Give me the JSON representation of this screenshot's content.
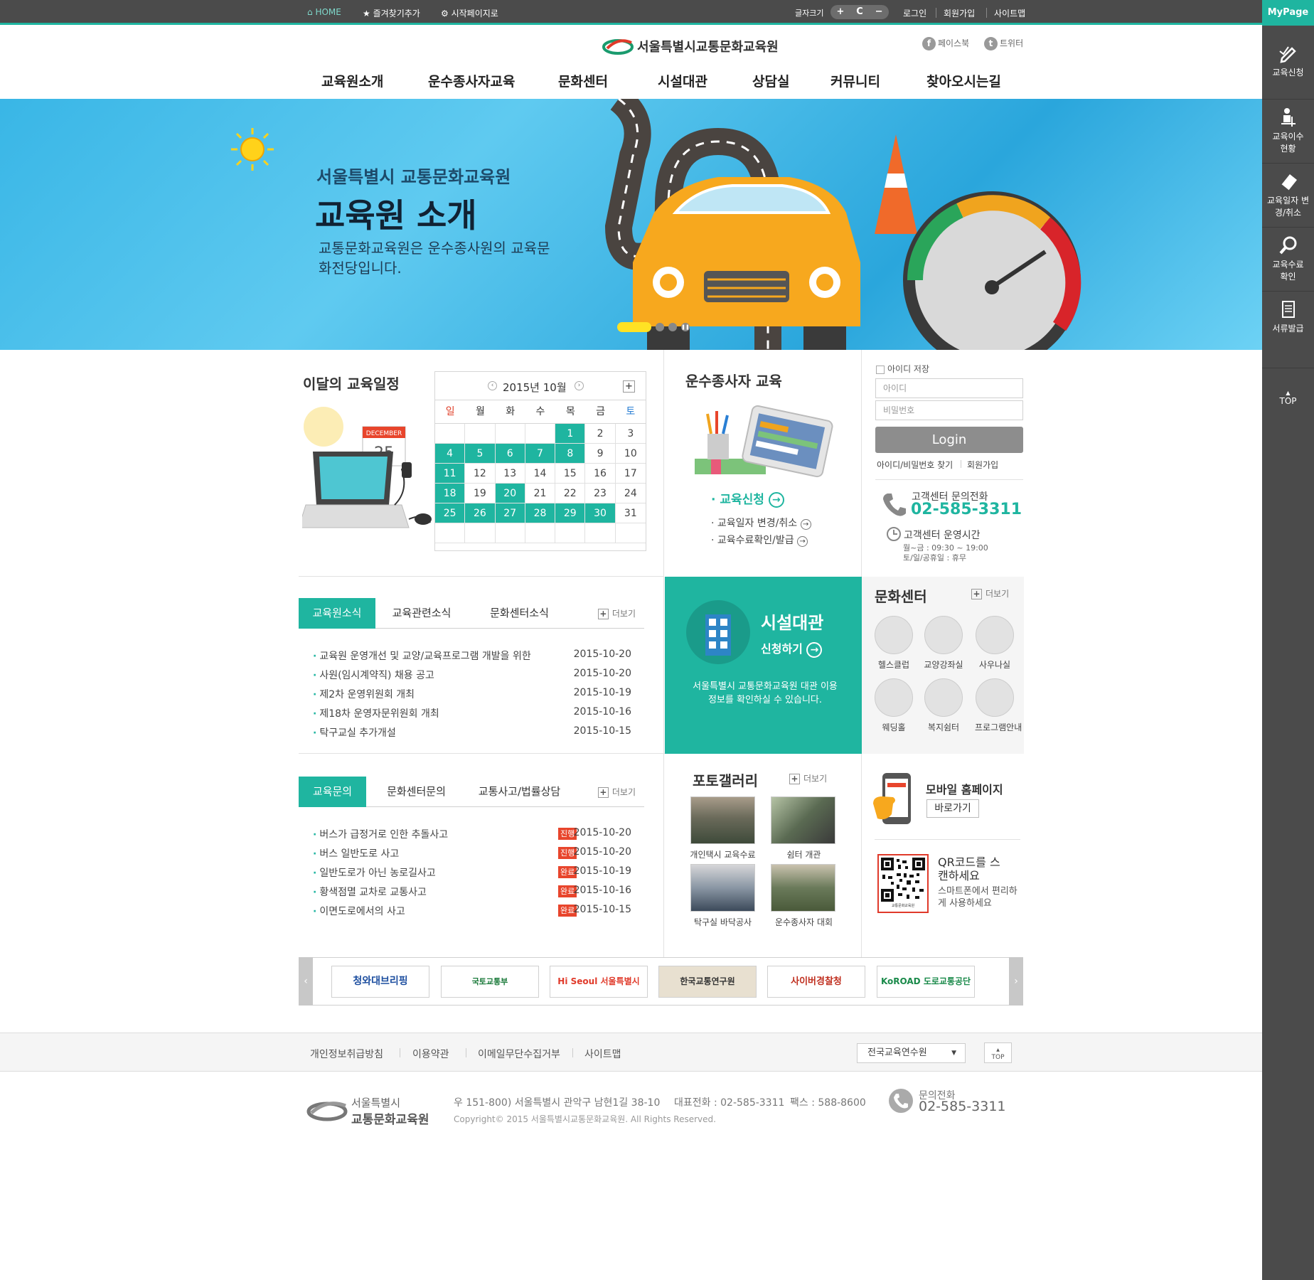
{
  "topbar": {
    "home": "HOME",
    "bookmark": "즐겨찾기추가",
    "startpage": "시작페이지로",
    "fontsize_label": "글자크기",
    "font_plus": "+",
    "font_reset": "C",
    "font_minus": "−",
    "login": "로그인",
    "join": "회원가입",
    "sitemap": "사이트맵"
  },
  "right_panel": {
    "mypage": "MyPage",
    "items": [
      "교육신청",
      "교육이수 현황",
      "교육일자 변경/취소",
      "교육수료 확인",
      "서류발급"
    ],
    "top": "TOP"
  },
  "header": {
    "logo": "서울특별시교통문화교육원",
    "facebook": "페이스북",
    "twitter": "트위터",
    "nav": [
      "교육원소개",
      "운수종사자교육",
      "문화센터",
      "시설대관",
      "상담실",
      "커뮤니티",
      "찾아오시는길"
    ]
  },
  "banner": {
    "subtitle": "서울특별시 교통문화교육원",
    "title": "교육원 소개",
    "desc": "교통문화교육원은 운수종사원의 교육문화전당입니다."
  },
  "schedule": {
    "title": "이달의 교육일정",
    "calendar_title": "2015년 10월",
    "illustration_text": "DECEMBER",
    "illustration_day": "25",
    "days": [
      "일",
      "월",
      "화",
      "수",
      "목",
      "금",
      "토"
    ],
    "cells": [
      "",
      "",
      "",
      "",
      "1",
      "2",
      "3",
      "4",
      "5",
      "6",
      "7",
      "8",
      "9",
      "10",
      "11",
      "12",
      "13",
      "14",
      "15",
      "16",
      "17",
      "18",
      "19",
      "20",
      "21",
      "22",
      "23",
      "24",
      "25",
      "26",
      "27",
      "28",
      "29",
      "30",
      "31",
      "",
      "",
      "",
      "",
      "",
      "",
      ""
    ],
    "highlighted": [
      "1",
      "4",
      "5",
      "6",
      "7",
      "8",
      "11",
      "18",
      "20",
      "25",
      "26",
      "27",
      "28",
      "29",
      "30"
    ],
    "colors": {
      "accent": "#1fb5a0",
      "sunday": "#e0402a",
      "saturday": "#2a7fd4"
    }
  },
  "driver_edu": {
    "title": "운수종사자 교육",
    "apply": "교육신청",
    "links": [
      "교육일자 변경/취소",
      "교육수료확인/발급"
    ]
  },
  "login": {
    "save_id": "아이디 저장",
    "id_placeholder": "아이디",
    "pw_placeholder": "비밀번호",
    "button": "Login",
    "find": "아이디/비밀번호 찾기",
    "join": "회원가입",
    "cs_label": "고객센터 문의전화",
    "cs_phone": "02-585-3311",
    "hours_label": "고객센터 운영시간",
    "hours_weekday": "월~금 : 09:30 ~ 19:00",
    "hours_weekend": "토/일/공휴일 : 휴무"
  },
  "news": {
    "tabs": [
      "교육원소식",
      "교육관련소식",
      "문화센터소식"
    ],
    "more": "더보기",
    "items": [
      {
        "title": "교육원 운영개선 및 교양/교육프로그램 개발을 위한",
        "date": "2015-10-20"
      },
      {
        "title": "사원(임시계약직) 채용 공고",
        "date": "2015-10-20"
      },
      {
        "title": "제2차 운영위원회 개최",
        "date": "2015-10-19"
      },
      {
        "title": "제18차 운영자문위원회 개최",
        "date": "2015-10-16"
      },
      {
        "title": "탁구교실 추가개설",
        "date": "2015-10-15"
      }
    ]
  },
  "facility": {
    "title": "시설대관",
    "apply": "신청하기",
    "desc": "서울특별시 교통문화교육원 대관 이용정보를 확인하실 수 있습니다."
  },
  "culture": {
    "title": "문화센터",
    "more": "더보기",
    "items": [
      "헬스클럽",
      "교양강좌실",
      "사우나실",
      "웨딩홀",
      "복지쉼터",
      "프로그램안내"
    ]
  },
  "inquiry": {
    "tabs": [
      "교육문의",
      "문화센터문의",
      "교통사고/법률상담"
    ],
    "more": "더보기",
    "items": [
      {
        "title": "버스가 급정거로 인한 추돌사고",
        "status": "진행",
        "date": "2015-10-20"
      },
      {
        "title": "버스 일반도로 사고",
        "status": "진행",
        "date": "2015-10-20"
      },
      {
        "title": "일반도로가 아닌 농로길사고",
        "status": "완료",
        "date": "2015-10-19"
      },
      {
        "title": "황색점멸 교차로 교통사고",
        "status": "완료",
        "date": "2015-10-16"
      },
      {
        "title": "이면도로에서의 사고",
        "status": "완료",
        "date": "2015-10-15"
      }
    ],
    "status_colors": {
      "진행": "#e8452c",
      "완료": "#e8452c"
    }
  },
  "gallery": {
    "title": "포토갤러리",
    "more": "더보기",
    "items": [
      "개인택시 교육수료",
      "쉼터 개관",
      "탁구실 바닥공사",
      "운수종사자 대회"
    ]
  },
  "mobile": {
    "title": "모바일 홈페이지",
    "button": "바로가기",
    "qr_title": "QR코드를 스캔하세요",
    "qr_desc": "스마트폰에서 편리하게 사용하세요",
    "qr_caption": "교통문화교육원"
  },
  "partners": {
    "prev": "‹",
    "next": "›",
    "items": [
      "청와대브리핑",
      "국토교통부",
      "Hi Seoul 서울특별시",
      "한국교통연구원",
      "사이버경찰청",
      "KoROAD 도로교통공단"
    ]
  },
  "footer": {
    "links": [
      "개인정보취급방침",
      "이용약관",
      "이메일무단수집거부",
      "사이트맵"
    ],
    "family_select": "전국교육연수원",
    "top": "TOP",
    "logo_line1": "서울특별시",
    "logo_line2": "교통문화교육원",
    "address": "우 151-800) 서울특별시 관악구 남현1길 38-10",
    "tel": "대표전화 : 02-585-3311",
    "fax": "팩스 : 588-8600",
    "copyright": "Copyright© 2015 서울특별시교통문화교육원. All Rights Reserved.",
    "phone_label": "문의전화",
    "phone": "02-585-3311"
  }
}
